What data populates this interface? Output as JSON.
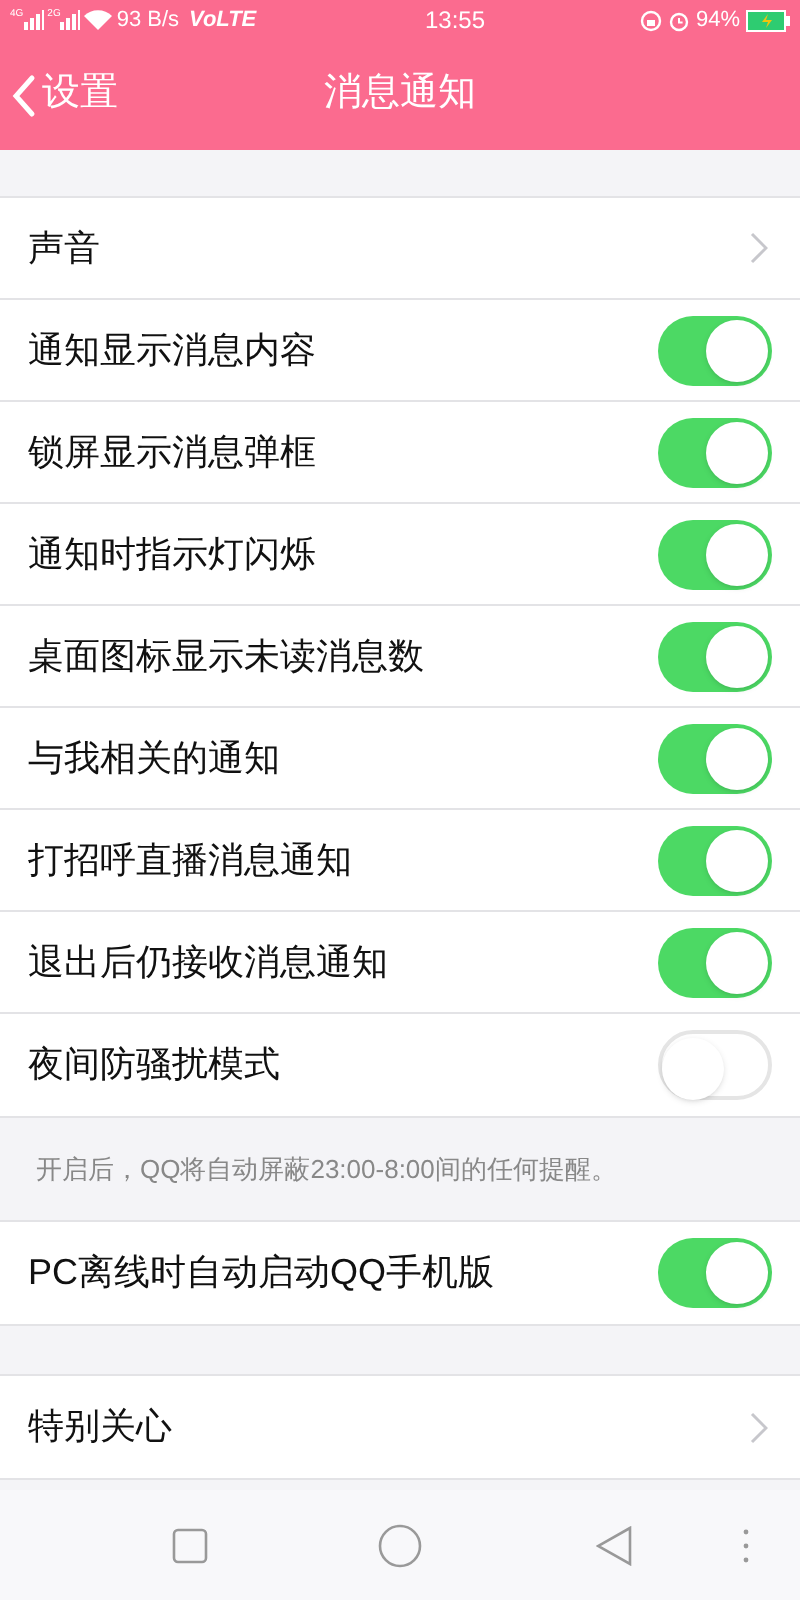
{
  "status_bar": {
    "sim_labels": [
      "4G",
      "2G"
    ],
    "speed": "93 B/s",
    "network": "VoLTE",
    "time": "13:55",
    "battery": "94%"
  },
  "header": {
    "back": "设置",
    "title": "消息通知"
  },
  "groups": [
    {
      "items": [
        {
          "kind": "link",
          "label": "声音"
        },
        {
          "kind": "toggle",
          "label": "通知显示消息内容",
          "on": true
        },
        {
          "kind": "toggle",
          "label": "锁屏显示消息弹框",
          "on": true
        },
        {
          "kind": "toggle",
          "label": "通知时指示灯闪烁",
          "on": true
        },
        {
          "kind": "toggle",
          "label": "桌面图标显示未读消息数",
          "on": true
        },
        {
          "kind": "toggle",
          "label": "与我相关的通知",
          "on": true
        },
        {
          "kind": "toggle",
          "label": "打招呼直播消息通知",
          "on": true
        },
        {
          "kind": "toggle",
          "label": "退出后仍接收消息通知",
          "on": true
        },
        {
          "kind": "toggle",
          "label": "夜间防骚扰模式",
          "on": false
        }
      ],
      "note": "开启后，QQ将自动屏蔽23:00-8:00间的任何提醒。"
    },
    {
      "items": [
        {
          "kind": "toggle",
          "label": "PC离线时自动启动QQ手机版",
          "on": true
        }
      ]
    },
    {
      "items": [
        {
          "kind": "link",
          "label": "特别关心"
        }
      ]
    }
  ]
}
